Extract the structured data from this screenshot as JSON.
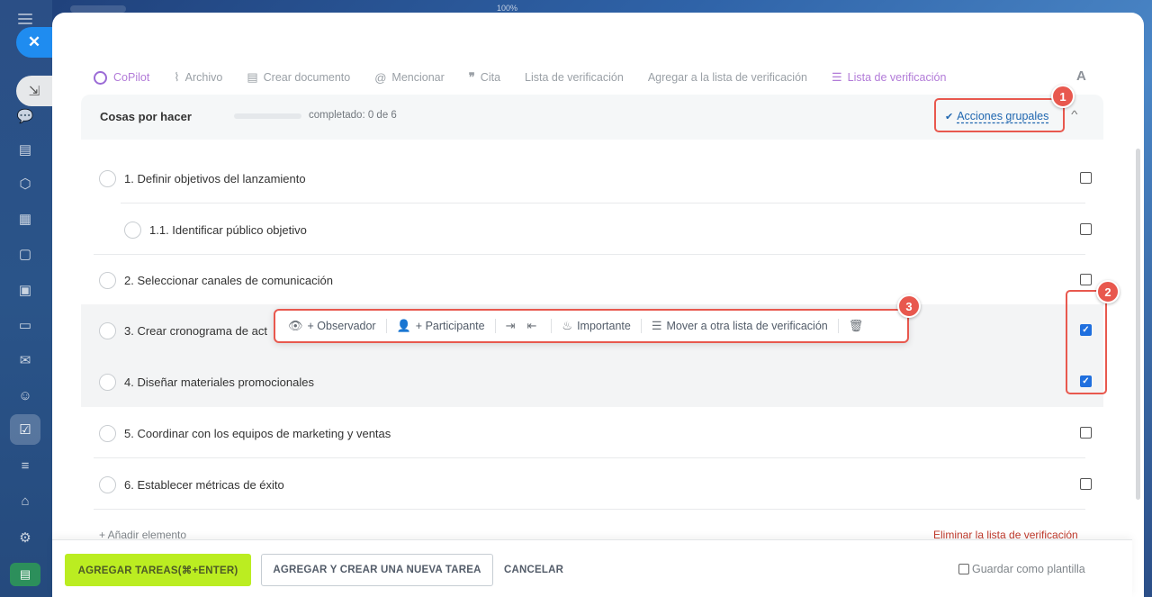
{
  "zoom": "100%",
  "toolbar": {
    "items": [
      {
        "icon": "copilot-icon",
        "label": "CoPilot"
      },
      {
        "icon": "paperclip-icon",
        "label": "Archivo"
      },
      {
        "icon": "document-icon",
        "label": "Crear documento"
      },
      {
        "icon": "at-icon",
        "label": "Mencionar"
      },
      {
        "icon": "quote-icon",
        "label": "Cita"
      },
      {
        "icon": "",
        "label": "Lista de verificación"
      },
      {
        "icon": "",
        "label": "Agregar a la lista de verificación"
      },
      {
        "icon": "checklist-add-icon",
        "label": "Lista de verificación"
      }
    ],
    "font_button": "A"
  },
  "checklist": {
    "title": "Cosas por hacer",
    "progress_fraction": 0,
    "completed_text": "completado: 0 de 6",
    "group_actions": "Acciones grupales",
    "items": [
      {
        "text": "1. Definir objetivos del lanzamiento",
        "level": 0,
        "checked": false
      },
      {
        "text": "1.1. Identificar público objetivo",
        "level": 1,
        "checked": false
      },
      {
        "text": "2. Seleccionar canales de comunicación",
        "level": 0,
        "checked": false
      },
      {
        "text": "3. Crear cronograma de act",
        "level": 0,
        "checked": true
      },
      {
        "text": "4. Diseñar materiales promocionales",
        "level": 0,
        "checked": true
      },
      {
        "text": "5. Coordinar con los equipos de marketing y ventas",
        "level": 0,
        "checked": false
      },
      {
        "text": "6. Establecer métricas de éxito",
        "level": 0,
        "checked": false
      }
    ],
    "add_item": "+ Añadir elemento",
    "delete_list": "Eliminar la lista de verificación"
  },
  "action_bar": {
    "observer": "+ Observador",
    "participant": "+ Participante",
    "important": "Importante",
    "move": "Mover a otra lista de verificación"
  },
  "annotations": {
    "badge1": "1",
    "badge2": "2",
    "badge3": "3"
  },
  "footer": {
    "add_tasks": "AGREGAR TAREAS(⌘+ENTER)",
    "add_and_new": "AGREGAR Y CREAR UNA NUEVA TAREA",
    "cancel": "CANCELAR",
    "save_template": "Guardar como plantilla"
  },
  "colors": {
    "accent": "#2067b0",
    "primary_button": "#bbed21",
    "annotation": "#e8584e",
    "checked": "#1f6fde"
  }
}
